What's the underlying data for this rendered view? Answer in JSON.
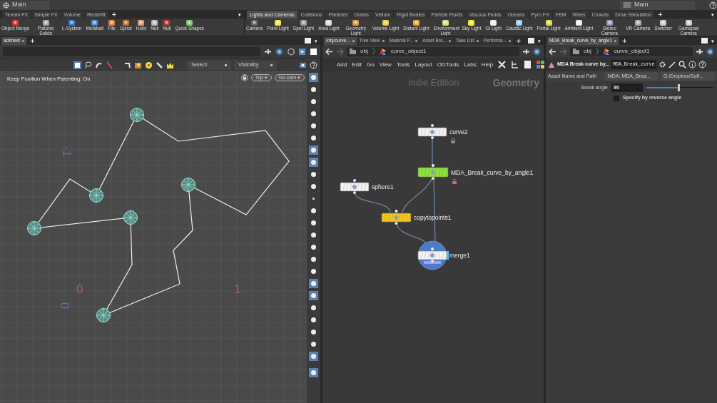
{
  "desktop_menu": {
    "label": "Main"
  },
  "desktop_menu_right": {
    "label": "Main"
  },
  "left_shelf": {
    "tabs": [
      {
        "label": "Terrain FX",
        "selected": false
      },
      {
        "label": "Simple FX",
        "selected": false
      },
      {
        "label": "Volume",
        "selected": false
      },
      {
        "label": "Redshift",
        "selected": false
      }
    ],
    "add": "+",
    "menu": "▾",
    "tools": [
      "Object Merge",
      "Platonic Solids",
      "L-System",
      "Metaball",
      "File",
      "Spiral",
      "Helix",
      "Null",
      "Null",
      "Quick Shapes"
    ]
  },
  "right_shelf": {
    "tabs": [
      {
        "label": "Lights and Cameras",
        "selected": true
      },
      {
        "label": "Collisions",
        "selected": false
      },
      {
        "label": "Particles",
        "selected": false
      },
      {
        "label": "Grains",
        "selected": false
      },
      {
        "label": "Vellum",
        "selected": false
      },
      {
        "label": "Rigid Bodies",
        "selected": false
      },
      {
        "label": "Particle Fluids",
        "selected": false
      },
      {
        "label": "Viscous Fluids",
        "selected": false
      },
      {
        "label": "Oceans",
        "selected": false
      },
      {
        "label": "Pyro FX",
        "selected": false
      },
      {
        "label": "FEM",
        "selected": false
      },
      {
        "label": "Wires",
        "selected": false
      },
      {
        "label": "Crowds",
        "selected": false
      },
      {
        "label": "Drive Simulation",
        "selected": false
      }
    ],
    "add": "+",
    "menu": "▾",
    "tools": [
      "Camera",
      "Point Light",
      "Spot Light",
      "Area Light",
      "Geometry Light",
      "Volume Light",
      "Distant Light",
      "Environment Light",
      "Sky Light",
      "GI Light",
      "Caustic Light",
      "Portal Light",
      "Ambient Light",
      "Stereo Camera",
      "VR Camera",
      "Switcher",
      "Gamepad Camera"
    ]
  },
  "viewport_pane": {
    "tabs": [
      {
        "label": "adsheet",
        "selected": true
      }
    ],
    "add": "+",
    "menu": "▾",
    "select_mode": "Select",
    "visibility": "Visibility",
    "status": "Keep Position When Parenting: On",
    "view": "Top ▾",
    "camera": "No cam ▾",
    "axis_labels": [
      {
        "text": "-1",
        "kind": "vertical"
      },
      {
        "text": "0",
        "kind": "horizontal"
      },
      {
        "text": "1",
        "kind": "horizontal"
      },
      {
        "text": "0",
        "kind": "vertical"
      }
    ]
  },
  "network_pane": {
    "tabs": [
      {
        "label": "/obj/curve...",
        "selected": true
      },
      {
        "label": "Tree View",
        "selected": false
      },
      {
        "label": "Material P...",
        "selected": false
      },
      {
        "label": "Asset Bro...",
        "selected": false
      },
      {
        "label": "Take List",
        "selected": false
      },
      {
        "label": "Performa...",
        "selected": false
      }
    ],
    "add": "+",
    "menu": "▾",
    "path": [
      "obj",
      "curve_object1"
    ],
    "menu_items": [
      "Add",
      "Edit",
      "Go",
      "View",
      "Tools",
      "Layout",
      "ODTools",
      "Labs",
      "Help"
    ],
    "edition": "Indie Edition",
    "context": "Geometry",
    "nodes": [
      {
        "name": "curve2",
        "color": "#f2f2f2",
        "kind": "locked",
        "display": false
      },
      {
        "name": "MDA_Break_curve_by_angle1",
        "color": "#8ee03a",
        "kind": "unlocked",
        "display": false
      },
      {
        "name": "sphere1",
        "color": "#f2f2f2",
        "kind": "plain",
        "display": false
      },
      {
        "name": "copytopoints1",
        "color": "#f5c518",
        "kind": "plain",
        "display": false
      },
      {
        "name": "merge1",
        "color": "#f2f2f2",
        "kind": "plain",
        "display": true
      }
    ]
  },
  "parameter_pane": {
    "tabs": [
      {
        "label": "MDA_Break_curve_by_angle1",
        "selected": true
      }
    ],
    "add": "+",
    "menu": "▾",
    "path": [
      "obj",
      "curve_object1"
    ],
    "node_type": "MDA Break curve by...",
    "node_name": "MDA_Break_curve",
    "asset_label": "Asset Name and Path",
    "asset_name": "MDA::MDA_Brea...",
    "asset_path": "G:/Dropbox/Soft...",
    "break_angle": {
      "label": "Break angle",
      "value": "90",
      "level": 0.48
    },
    "reverse": {
      "label": "Specify by reverse angle",
      "checked": false
    }
  }
}
